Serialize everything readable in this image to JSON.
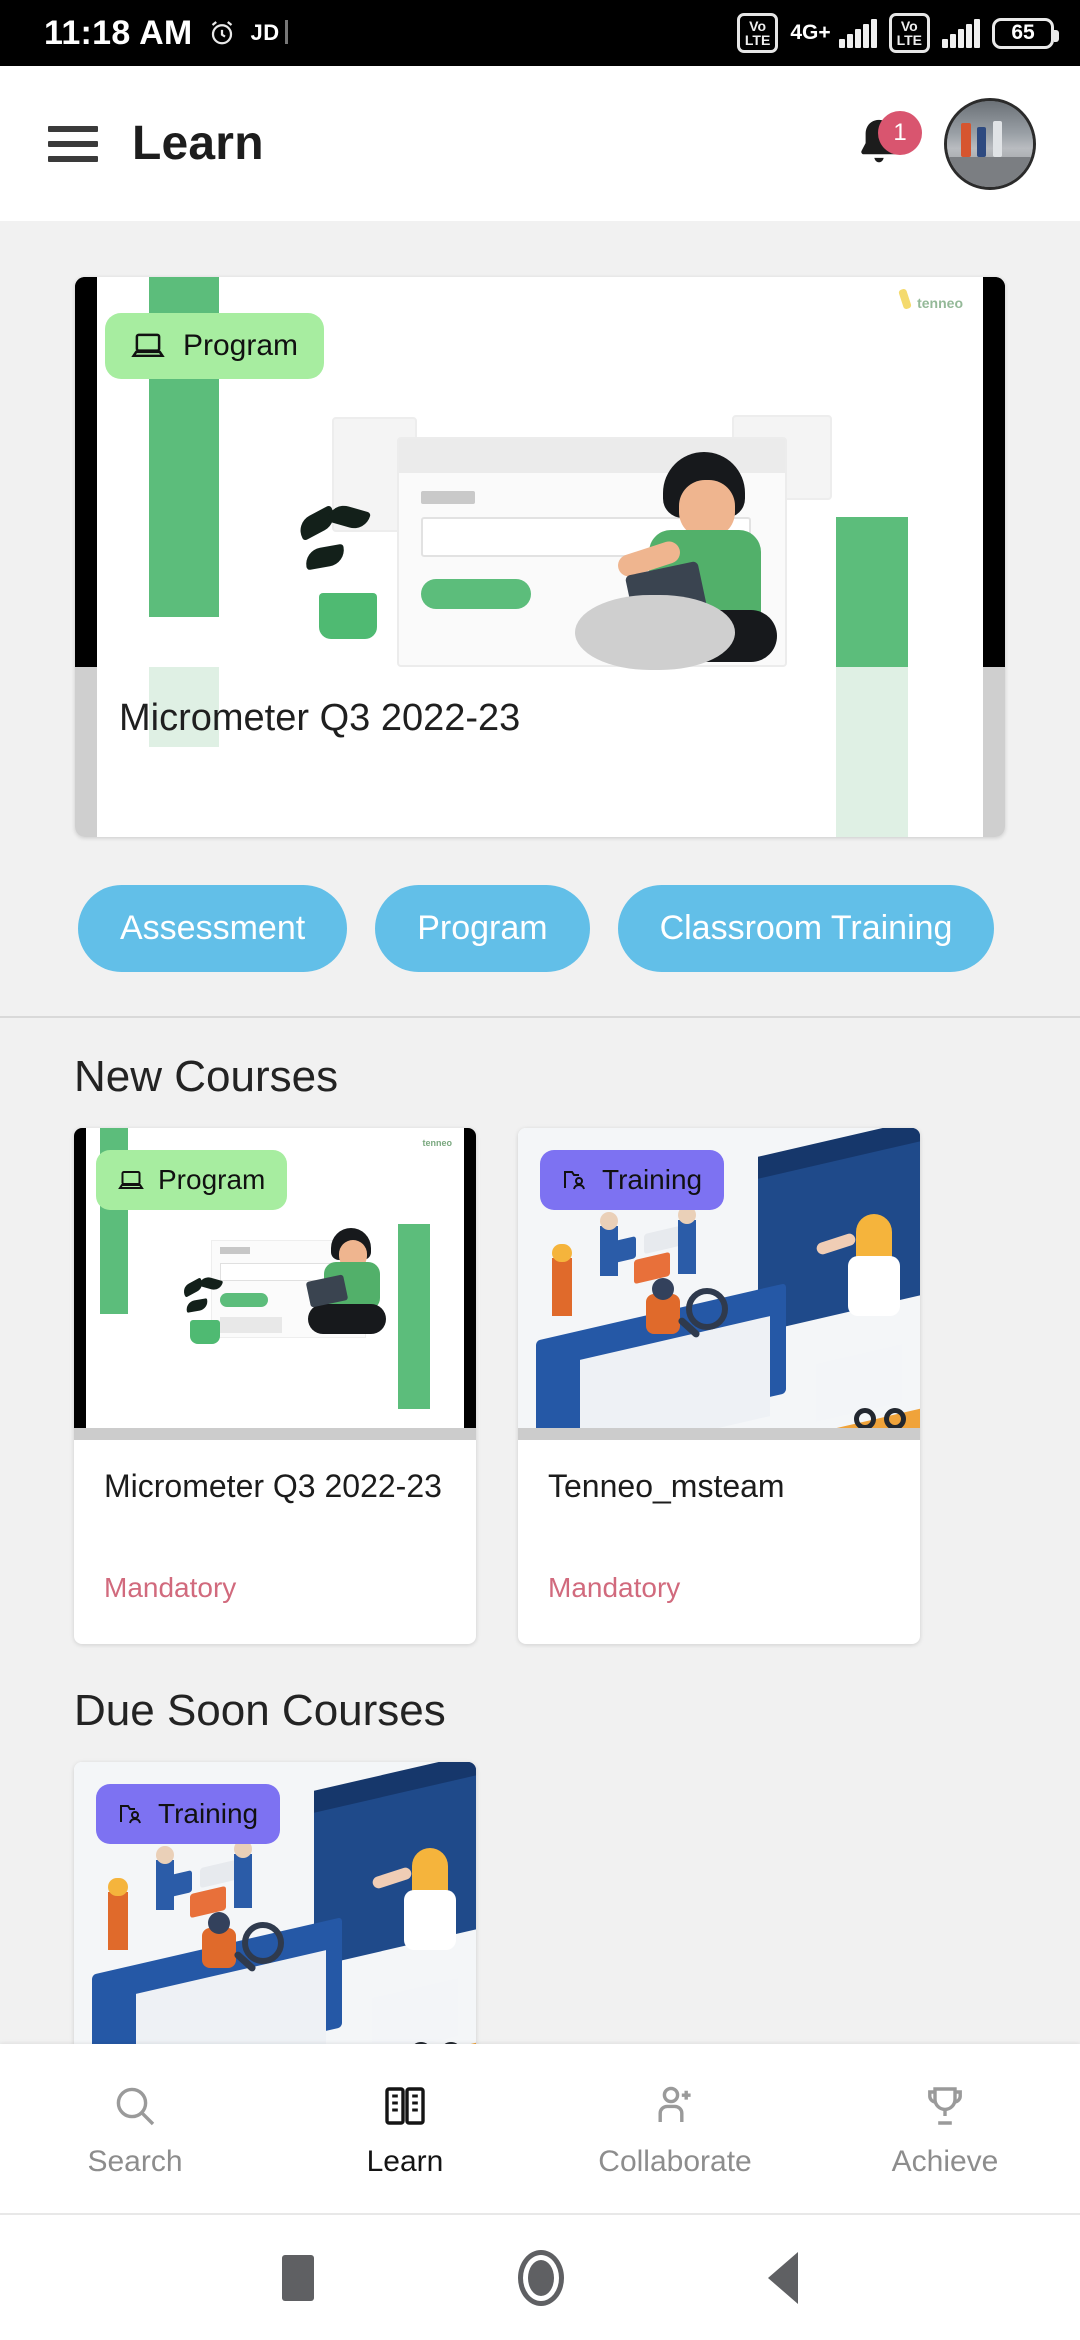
{
  "status_bar": {
    "time": "11:18 AM",
    "alarm_icon": "alarm-icon",
    "app_tag": "JD",
    "sim1_volte": [
      "Vo",
      "LTE"
    ],
    "network_type": "4G+",
    "sim2_volte": [
      "Vo",
      "LTE"
    ],
    "battery_level": "65"
  },
  "app_bar": {
    "menu_icon": "hamburger-menu-icon",
    "title": "Learn",
    "notification_icon": "bell-icon",
    "notification_count": "1",
    "avatar": "user-avatar"
  },
  "hero": {
    "badge_label": "Program",
    "badge_icon": "laptop-icon",
    "badge_color": "#a7eda0",
    "title": "Micrometer Q3 2022-23",
    "watermark": "tenneo"
  },
  "chips": [
    {
      "label": "Assessment"
    },
    {
      "label": "Program"
    },
    {
      "label": "Classroom Training"
    }
  ],
  "chip_color": "#62bfe8",
  "sections": [
    {
      "title": "New Courses",
      "cards": [
        {
          "badge_label": "Program",
          "badge_icon": "laptop-icon",
          "badge_color": "#a7eda0",
          "title": "Micrometer Q3 2022-23",
          "tag": "Mandatory",
          "tag_color": "#d16a7d",
          "thumbnail": "program-illustration"
        },
        {
          "badge_label": "Training",
          "badge_icon": "folder-person-icon",
          "badge_color": "#7d72f2",
          "title": "Tenneo_msteam",
          "tag": "Mandatory",
          "tag_color": "#d16a7d",
          "thumbnail": "training-illustration"
        }
      ]
    },
    {
      "title": "Due Soon Courses",
      "cards": [
        {
          "badge_label": "Training",
          "badge_icon": "folder-person-icon",
          "badge_color": "#7d72f2",
          "title": "",
          "tag": "",
          "tag_color": "#d16a7d",
          "thumbnail": "training-illustration"
        }
      ]
    }
  ],
  "bottom_nav": [
    {
      "label": "Search",
      "icon": "search-icon",
      "active": false
    },
    {
      "label": "Learn",
      "icon": "open-book-icon",
      "active": true
    },
    {
      "label": "Collaborate",
      "icon": "person-add-icon",
      "active": false
    },
    {
      "label": "Achieve",
      "icon": "trophy-icon",
      "active": false
    }
  ],
  "android_nav": {
    "recents": "recents-square-icon",
    "home": "home-circle-icon",
    "back": "back-triangle-icon"
  }
}
